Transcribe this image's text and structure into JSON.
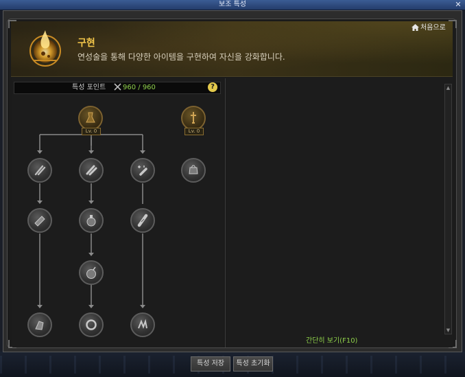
{
  "window": {
    "title": "보조 특성",
    "close_glyph": "✕"
  },
  "header": {
    "title": "구현",
    "description": "연성술을 통해 다양한 아이템을 구현하여 자신을 강화합니다.",
    "home_label": "처음으로"
  },
  "points": {
    "label": "특성 포인트",
    "value": "960 / 960",
    "help": "?"
  },
  "tree": {
    "root_nodes": [
      {
        "icon": "alchemy-flask-icon",
        "level": "Lv. 0"
      },
      {
        "icon": "sword-emblem-icon",
        "level": "Lv. 0"
      }
    ],
    "nodes": [
      {
        "icon": "dagger-swap-icon"
      },
      {
        "icon": "scroll-roll-icon"
      },
      {
        "icon": "sparkle-tube-icon"
      },
      {
        "icon": "pouch-icon"
      },
      {
        "icon": "fist-scroll-icon"
      },
      {
        "icon": "potion-icon"
      },
      {
        "icon": "bandage-icon"
      },
      {
        "icon": "bomb-icon"
      },
      {
        "icon": "gauntlet-icon"
      },
      {
        "icon": "ring-icon"
      },
      {
        "icon": "claw-icon"
      }
    ]
  },
  "detail": {
    "simple_view_label": "간단히 보기(F10)"
  },
  "footer": {
    "save_label": "특성 저장",
    "reset_label": "특성 초기화"
  },
  "colors": {
    "accent_gold": "#f3c64a",
    "accent_green": "#8fd14a"
  }
}
